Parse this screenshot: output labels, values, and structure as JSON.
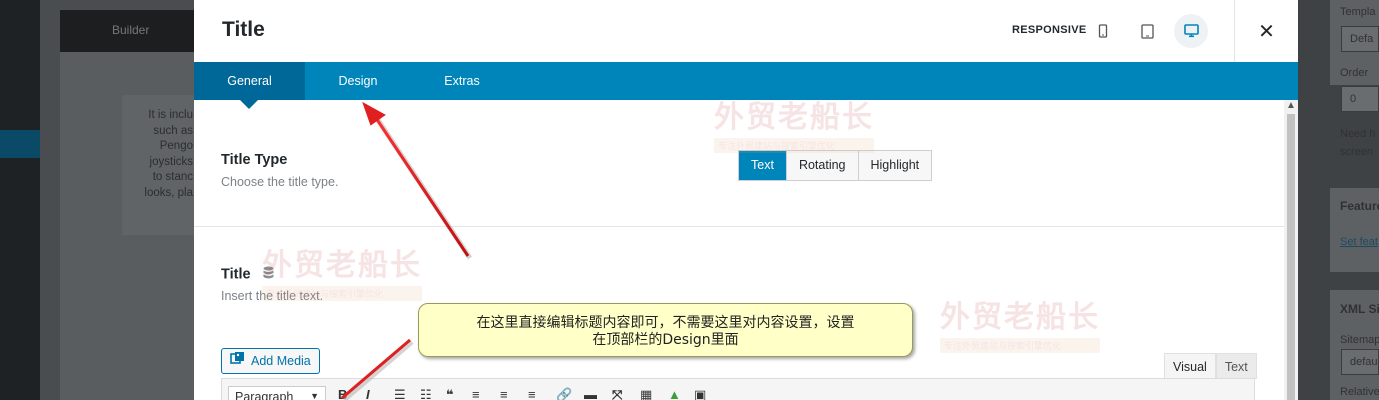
{
  "background": {
    "builder_label": "Builder",
    "left_text_lines": [
      "It is inclu",
      "such as",
      "Pengo",
      "joysticks",
      "to stanc",
      "looks, pla"
    ],
    "right_sidebar": {
      "template_label": "Templa",
      "template_value": "Defa",
      "order_label": "Order",
      "order_value": "0",
      "help_line1": "Need h",
      "help_line2": "screen",
      "featured_heading": "Feature",
      "featured_link": "Set feat",
      "xml_heading": "XML Si",
      "sitemap_label": "Sitemap",
      "sitemap_value": "defau",
      "relative_label": "Relative"
    }
  },
  "modal": {
    "title": "Title",
    "responsive_label": "RESPONSIVE",
    "close_glyph": "✕",
    "tabs": [
      {
        "label": "General",
        "active": true
      },
      {
        "label": "Design",
        "active": false
      },
      {
        "label": "Extras",
        "active": false
      }
    ],
    "title_type": {
      "heading": "Title Type",
      "description": "Choose the title type.",
      "options": [
        {
          "label": "Text",
          "active": true
        },
        {
          "label": "Rotating",
          "active": false
        },
        {
          "label": "Highlight",
          "active": false
        }
      ]
    },
    "title_field": {
      "heading": "Title",
      "description": "Insert the title text."
    },
    "editor": {
      "add_media_label": "Add Media",
      "visual_tab": "Visual",
      "text_tab": "Text",
      "format_select": "Paragraph",
      "bold_glyph": "B",
      "italic_glyph": "I"
    }
  },
  "watermark": {
    "main_text": "外贸老船长",
    "sub_text": "专注外贸建站与搜索引擎优化"
  },
  "annotation": {
    "callout_line1": "在这里直接编辑标题内容即可，不需要这里对内容设置，设置",
    "callout_line2": "在顶部栏的Design里面"
  },
  "colors": {
    "accent": "#0085ba",
    "active_tab": "#006799",
    "callout_bg": "#ffffc8",
    "arrow": "#e02020"
  }
}
